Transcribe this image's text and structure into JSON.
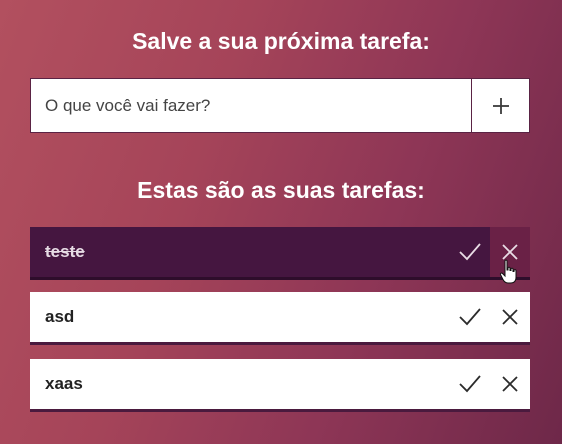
{
  "header": {
    "title": "Salve a sua próxima tarefa:"
  },
  "new_task": {
    "placeholder": "O que você vai fazer?",
    "add_icon": "plus-icon"
  },
  "list": {
    "title": "Estas são as suas tarefas:",
    "tasks": [
      {
        "label": "teste",
        "completed": true,
        "check_icon": "check-icon",
        "delete_icon": "close-icon"
      },
      {
        "label": "asd",
        "completed": false,
        "check_icon": "check-icon",
        "delete_icon": "close-icon"
      },
      {
        "label": "xaas",
        "completed": false,
        "check_icon": "check-icon",
        "delete_icon": "close-icon"
      }
    ]
  },
  "colors": {
    "background_start": "#b2505f",
    "background_end": "#6e2849",
    "completed_task": "#451640",
    "task_border": "#4a1a3e"
  }
}
